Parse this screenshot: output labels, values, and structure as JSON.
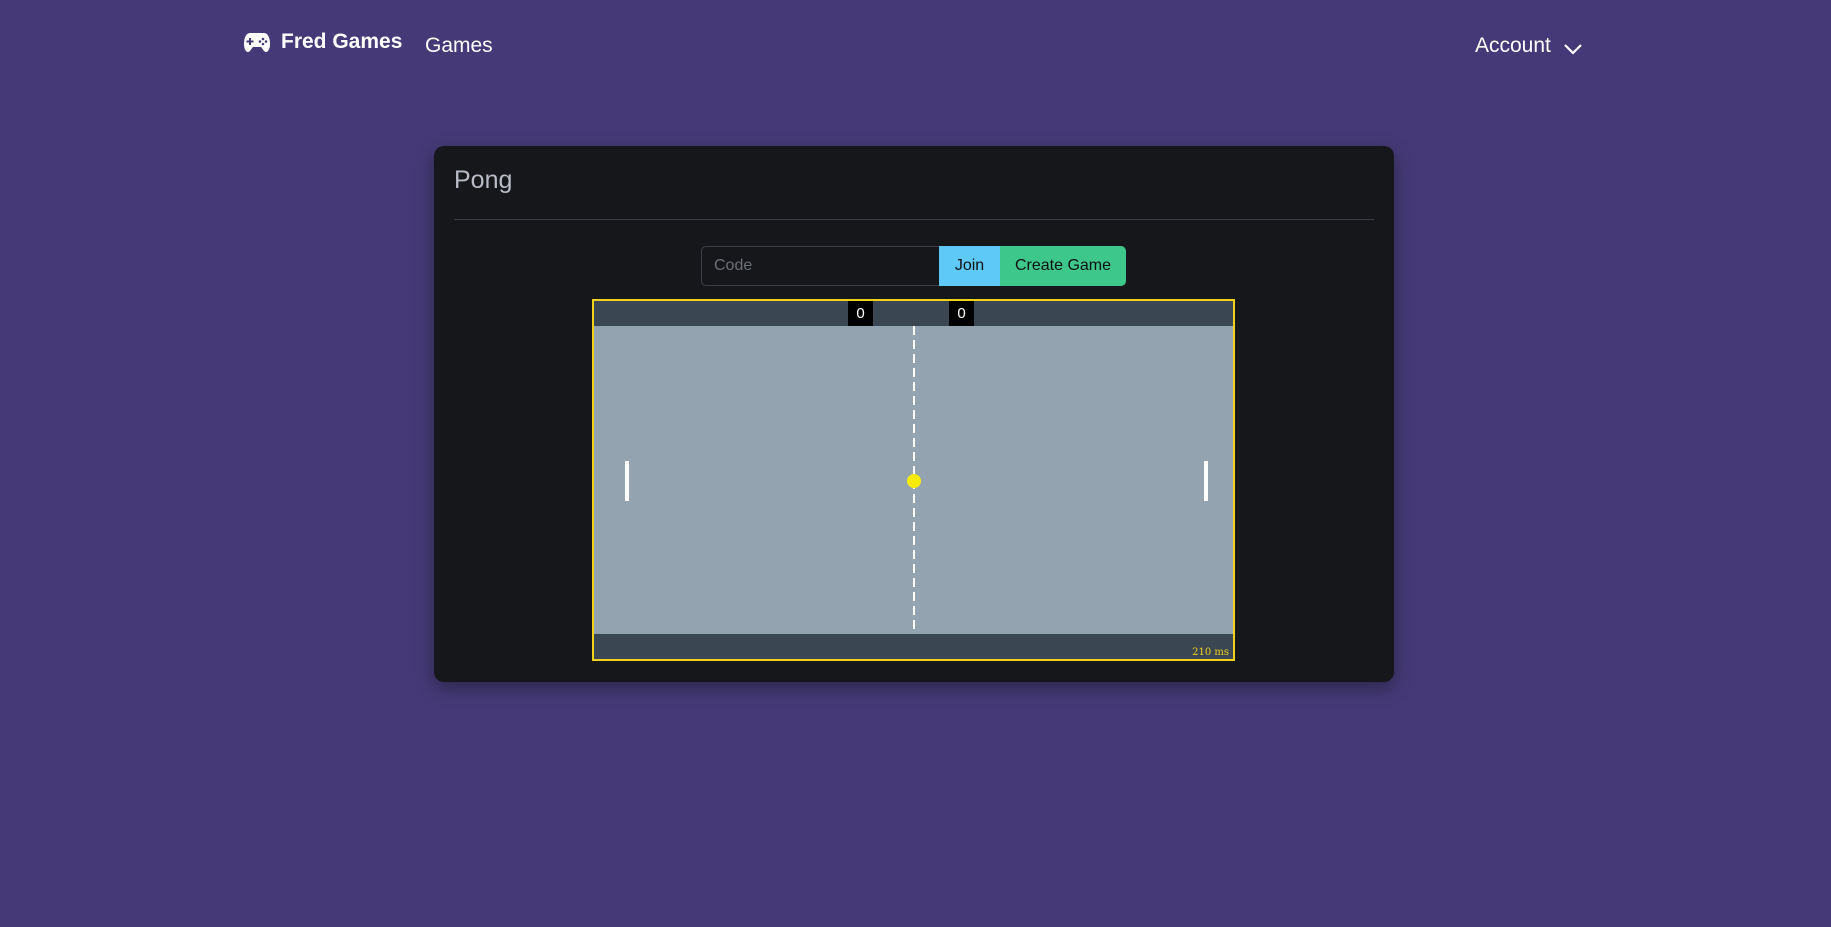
{
  "navbar": {
    "brand": "Fred Games",
    "brand_icon": "gamepad-icon",
    "games_link": "Games",
    "account_label": "Account",
    "account_icon": "chevron-down-icon"
  },
  "card": {
    "title": "Pong"
  },
  "controls": {
    "code_placeholder": "Code",
    "code_value": "",
    "join_label": "Join",
    "create_label": "Create Game"
  },
  "game": {
    "score_left": "0",
    "score_right": "0",
    "latency": "210 ms"
  },
  "colors": {
    "page_background": "#453a77",
    "card_background": "#16171b",
    "join_button": "#5ec8f7",
    "create_button": "#3ec78b",
    "board_border": "#f0d21a",
    "board_field": "#93a4b0",
    "ball": "#f5ec00"
  }
}
